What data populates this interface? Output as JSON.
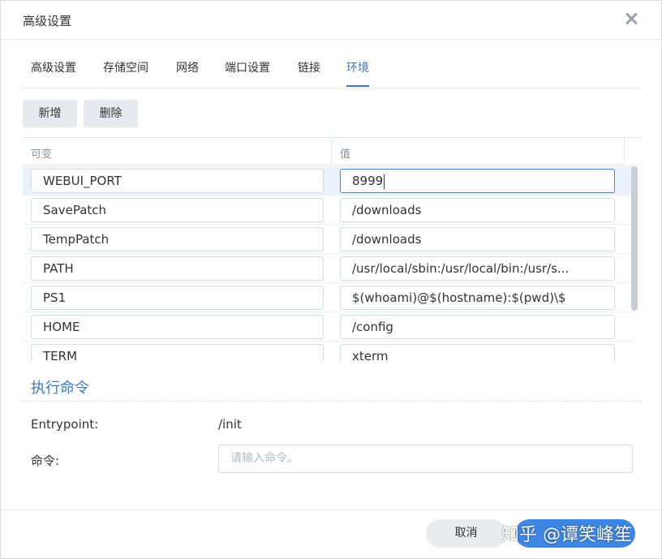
{
  "dialog": {
    "title": "高级设置"
  },
  "tabs": [
    {
      "label": "高级设置"
    },
    {
      "label": "存储空间"
    },
    {
      "label": "网络"
    },
    {
      "label": "端口设置"
    },
    {
      "label": "链接"
    },
    {
      "label": "环境"
    }
  ],
  "active_tab": "环境",
  "toolbar": {
    "add_label": "新增",
    "delete_label": "删除"
  },
  "grid": {
    "columns": [
      "可变",
      "值"
    ],
    "rows": [
      {
        "name": "WEBUI_PORT",
        "value": "8999"
      },
      {
        "name": "SavePatch",
        "value": "/downloads"
      },
      {
        "name": "TempPatch",
        "value": "/downloads"
      },
      {
        "name": "PATH",
        "value": "/usr/local/sbin:/usr/local/bin:/usr/s..."
      },
      {
        "name": "PS1",
        "value": "$(whoami)@$(hostname):$(pwd)\\$"
      },
      {
        "name": "HOME",
        "value": "/config"
      },
      {
        "name": "TERM",
        "value": "xterm"
      }
    ]
  },
  "exec": {
    "section_title": "执行命令",
    "entrypoint_label": "Entrypoint:",
    "entrypoint_value": "/init",
    "command_label": "命令:",
    "command_placeholder": "请输入命令。"
  },
  "footer": {
    "cancel_label": "取消"
  },
  "watermark": "知乎 @谭笑峰笙",
  "colors": {
    "accent": "#3d78c6",
    "primary_button": "#3d86e4",
    "button_bg": "#e6eaee"
  }
}
